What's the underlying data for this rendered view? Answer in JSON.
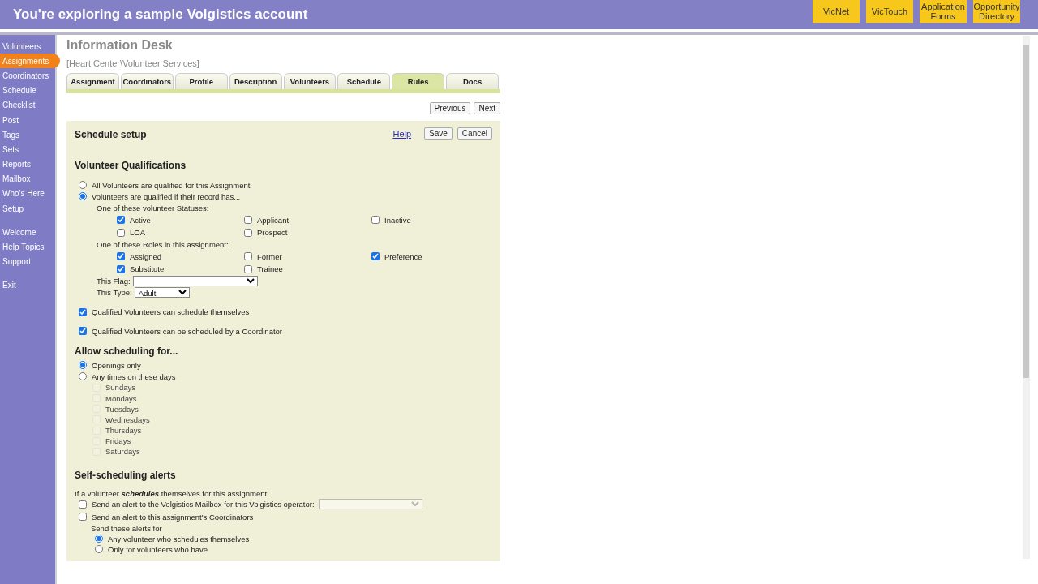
{
  "header": {
    "title": "You're exploring a sample Volgistics account",
    "links": [
      {
        "label": "VicNet"
      },
      {
        "label": "VicTouch"
      },
      {
        "label": "Application Forms"
      },
      {
        "label": "Opportunity Directory"
      }
    ]
  },
  "sidebar": {
    "groups": [
      [
        {
          "label": "Volunteers",
          "selected": false
        },
        {
          "label": "Assignments",
          "selected": true
        },
        {
          "label": "Coordinators",
          "selected": false
        },
        {
          "label": "Schedule",
          "selected": false
        },
        {
          "label": "Checklist",
          "selected": false
        },
        {
          "label": "Post",
          "selected": false
        },
        {
          "label": "Tags",
          "selected": false
        },
        {
          "label": "Sets",
          "selected": false
        },
        {
          "label": "Reports",
          "selected": false
        },
        {
          "label": "Mailbox",
          "selected": false
        },
        {
          "label": "Who's Here",
          "selected": false
        },
        {
          "label": "Setup",
          "selected": false
        }
      ],
      [
        {
          "label": "Welcome",
          "selected": false
        },
        {
          "label": "Help Topics",
          "selected": false
        },
        {
          "label": "Support",
          "selected": false
        }
      ],
      [
        {
          "label": "Exit",
          "selected": false
        }
      ]
    ]
  },
  "page": {
    "title": "Information Desk",
    "breadcrumb": "[Heart Center\\Volunteer Services]"
  },
  "tabs": [
    {
      "label": "Assignment",
      "selected": false
    },
    {
      "label": "Coordinators",
      "selected": false
    },
    {
      "label": "Profile",
      "selected": false
    },
    {
      "label": "Description",
      "selected": false
    },
    {
      "label": "Volunteers",
      "selected": false
    },
    {
      "label": "Schedule",
      "selected": false
    },
    {
      "label": "Rules",
      "selected": true
    },
    {
      "label": "Docs",
      "selected": false
    }
  ],
  "nav_buttons": [
    "Previous",
    "Next"
  ],
  "panel": {
    "title": "Schedule setup",
    "help_link": "Help",
    "buttons": [
      "Save",
      "Cancel"
    ],
    "qualifications": {
      "heading": "Volunteer Qualifications",
      "radios": [
        {
          "label": "All Volunteers are qualified for this Assignment",
          "selected": false
        },
        {
          "label": "Volunteers are qualified if their record has...",
          "selected": true
        }
      ],
      "groups": [
        {
          "label": "One of these volunteer Statuses:",
          "options": [
            {
              "label": "Active",
              "checked": true
            },
            {
              "label": "Applicant",
              "checked": false
            },
            {
              "label": "Inactive",
              "checked": false
            },
            {
              "label": "LOA",
              "checked": false
            },
            {
              "label": "Prospect",
              "checked": false
            }
          ]
        },
        {
          "label": "One of these Roles in this assignment:",
          "options": [
            {
              "label": "Assigned",
              "checked": true
            },
            {
              "label": "Former",
              "checked": false
            },
            {
              "label": "Preference",
              "checked": true
            },
            {
              "label": "Substitute",
              "checked": true
            },
            {
              "label": "Trainee",
              "checked": false
            }
          ]
        }
      ],
      "selects": [
        {
          "label": "This Flag:"
        },
        {
          "label": "This Type:",
          "value": "Adult"
        }
      ],
      "permissions": [
        {
          "label": "Qualified Volunteers can schedule themselves",
          "checked": true
        },
        {
          "label": "Qualified Volunteers can be scheduled by a Coordinator",
          "checked": true
        }
      ]
    },
    "allow": {
      "heading": "Allow scheduling for...",
      "radios": [
        {
          "label": "Openings only",
          "selected": true
        },
        {
          "label": "Any times on these days",
          "selected": false
        }
      ],
      "days": [
        {
          "label": "Sundays",
          "checked": false,
          "disabled": true
        },
        {
          "label": "Mondays",
          "checked": false,
          "disabled": true
        },
        {
          "label": "Tuesdays",
          "checked": false,
          "disabled": true
        },
        {
          "label": "Wednesdays",
          "checked": false,
          "disabled": true
        },
        {
          "label": "Thursdays",
          "checked": false,
          "disabled": true
        },
        {
          "label": "Fridays",
          "checked": false,
          "disabled": true
        },
        {
          "label": "Saturdays",
          "checked": false,
          "disabled": true
        }
      ]
    },
    "alerts": {
      "heading": "Self-scheduling alerts",
      "intro": "If a volunteer **schedules** themselves for this assignment:",
      "options": [
        {
          "label": "Send an alert to the Volgistics Mailbox for this Volgistics operator:",
          "checked": false,
          "kind": "select"
        },
        {
          "label": "Send an alert to this assignment's Coordinators",
          "checked": false,
          "kind": "plain"
        }
      ],
      "for_label": "Send these alerts for",
      "radios": [
        {
          "label": "Any volunteer who schedules themselves",
          "selected": true
        },
        {
          "label": "Only for volunteers who have",
          "selected": false
        }
      ]
    }
  }
}
